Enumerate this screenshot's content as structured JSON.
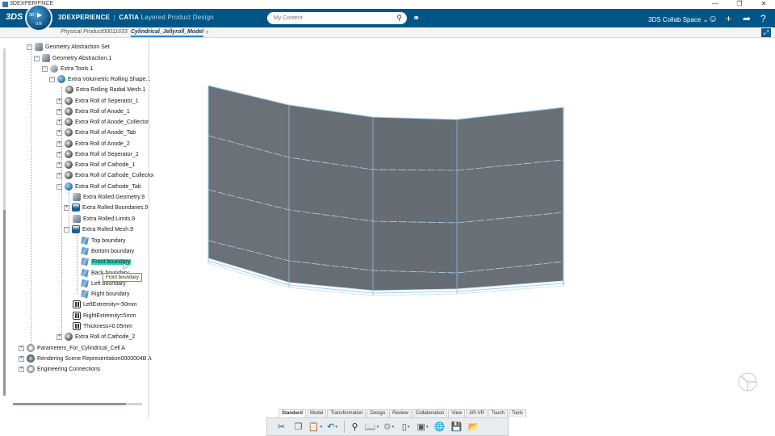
{
  "window": {
    "title": "3DEXPERIENCE",
    "controls": [
      "—",
      "❐",
      "✕"
    ]
  },
  "header": {
    "ds_logo": "3DS",
    "compass_version": "V.R",
    "compass_3d": "3D",
    "brand_bold": "3DEXPERIENCE",
    "brand_separator": "|",
    "brand_app": "CATIA",
    "brand_product": "Layered Product Design",
    "search_placeholder": "My Content",
    "collab_space": "3DS Collab Space",
    "colors": {
      "header_bg": "#005686",
      "highlight": "#2fd4b5"
    }
  },
  "tabs": [
    {
      "label": "Physical Product00011633"
    },
    {
      "label": "Cylindrical_Jellyroll_Model"
    }
  ],
  "tree": {
    "items": [
      {
        "label": "Geometry Abstraction Set"
      },
      {
        "label": "Geometry Abstraction.1"
      },
      {
        "label": "Extra Tools.1"
      },
      {
        "label": "Extra Volumetric Rolling Shape.1"
      },
      {
        "label": "Extra Rolling Radial Mesh.1"
      },
      {
        "label": "Extra Roll of Seperator_1"
      },
      {
        "label": "Extra Roll of Anode_1"
      },
      {
        "label": "Extra Roll of Anode_Collector"
      },
      {
        "label": "Extra Roll of Anode_Tab"
      },
      {
        "label": "Extra Roll of Anode_2"
      },
      {
        "label": "Extra Roll of Seperator_2"
      },
      {
        "label": "Extra Roll of Cathode_1"
      },
      {
        "label": "Extra Roll of Cathode_Collector"
      },
      {
        "label": "Extra Roll of Cathode_Tab"
      },
      {
        "label": "Extra Rolled Geometry.9"
      },
      {
        "label": "Extra Rolled Boundaries.9"
      },
      {
        "label": "Extra Rolled Limits.9"
      },
      {
        "label": "Extra Rolled Mesh.9"
      },
      {
        "label": "Top boundary"
      },
      {
        "label": "Bottom boundary"
      },
      {
        "label": "Front boundary"
      },
      {
        "label": "Back boundary"
      },
      {
        "label": "Left boundary"
      },
      {
        "label": "Right boundary"
      },
      {
        "label": "LeftExtremity=-50mm"
      },
      {
        "label": "RightExtremity=5mm"
      },
      {
        "label": "Thickness=0.05mm"
      },
      {
        "label": "Extra Roll of Cathode_2"
      },
      {
        "label": "Parameters_For_Cylindrical_Cell A"
      },
      {
        "label": "Rendering Scene Representation0000004B A"
      },
      {
        "label": "Engineering Connections"
      }
    ],
    "tooltip": "Front boundary"
  },
  "action_tabs": [
    "Standard",
    "Model",
    "Transformation",
    "Design",
    "Review",
    "Collaboration",
    "View",
    "AR-VR",
    "Touch",
    "Tools"
  ],
  "toolbar_icons": [
    "cut-icon",
    "copy-icon",
    "paste-icon",
    "undo-icon",
    "zoom-icon",
    "book-icon",
    "gear-icon",
    "plane-icon",
    "cube-icon",
    "globe-icon",
    "save-icon",
    "export-icon"
  ]
}
